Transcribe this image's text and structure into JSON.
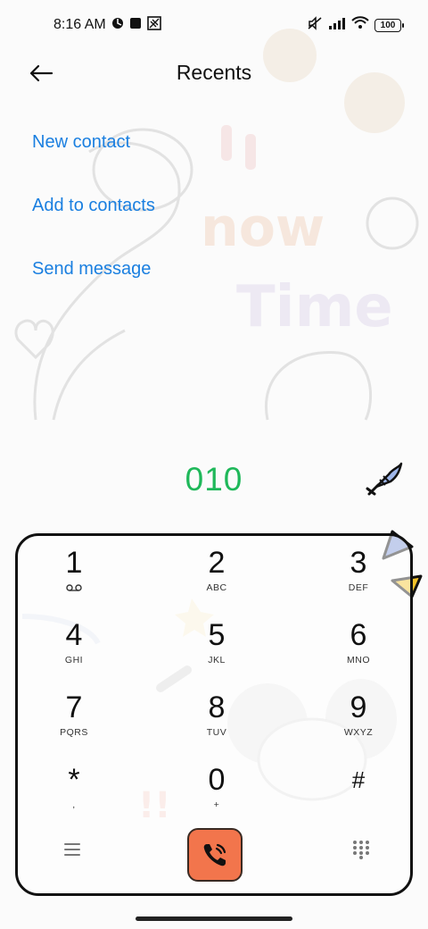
{
  "status_bar": {
    "time": "8:16 AM",
    "battery": "100",
    "icons_left": [
      "location-icon",
      "square-icon",
      "cast-icon"
    ],
    "icons_right": [
      "mute-icon",
      "signal-icon",
      "wifi-icon",
      "battery-icon"
    ]
  },
  "header": {
    "title": "Recents",
    "back_icon": "arrow-left-icon"
  },
  "actions": [
    {
      "label": "New contact"
    },
    {
      "label": "Add to contacts"
    },
    {
      "label": "Send message"
    }
  ],
  "dial": {
    "number": "010"
  },
  "keypad": {
    "keys": [
      {
        "digit": "1",
        "letters": ""
      },
      {
        "digit": "2",
        "letters": "ABC"
      },
      {
        "digit": "3",
        "letters": "DEF"
      },
      {
        "digit": "4",
        "letters": "GHI"
      },
      {
        "digit": "5",
        "letters": "JKL"
      },
      {
        "digit": "6",
        "letters": "MNO"
      },
      {
        "digit": "7",
        "letters": "PQRS"
      },
      {
        "digit": "8",
        "letters": "TUV"
      },
      {
        "digit": "9",
        "letters": "WXYZ"
      },
      {
        "digit": "*",
        "letters": ","
      },
      {
        "digit": "0",
        "letters": "+"
      },
      {
        "digit": "#",
        "letters": ""
      }
    ],
    "bottom": {
      "menu_icon": "menu-icon",
      "call_icon": "phone-call-icon",
      "keypad_icon": "dialpad-icon"
    }
  },
  "colors": {
    "accent_link": "#1a7fe0",
    "number_green": "#1fb85a",
    "call_orange": "#f2754c"
  }
}
